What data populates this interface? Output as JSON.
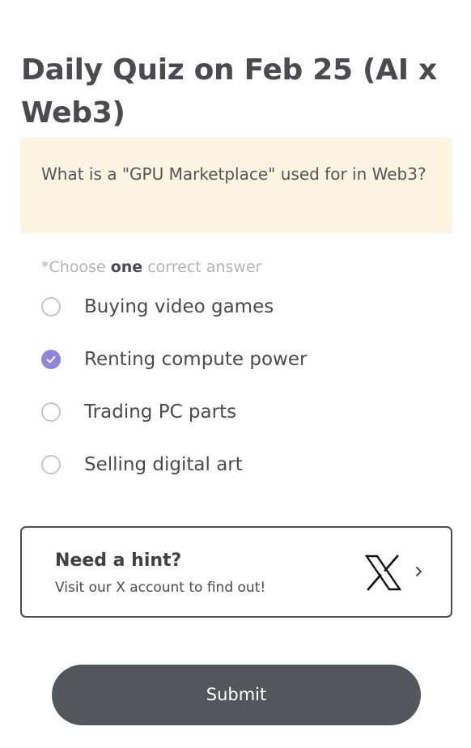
{
  "quiz": {
    "title": "Daily Quiz on Feb 25 (AI x Web3)",
    "question": "What is a \"GPU Marketplace\" used for in Web3?",
    "instruction": {
      "prefix": "*Choose ",
      "emphasis": "one",
      "suffix": " correct answer"
    },
    "options": [
      {
        "label": "Buying video games",
        "selected": false
      },
      {
        "label": "Renting compute power",
        "selected": true
      },
      {
        "label": "Trading PC parts",
        "selected": false
      },
      {
        "label": "Selling digital art",
        "selected": false
      }
    ]
  },
  "hint": {
    "title": "Need a hint?",
    "subtitle": "Visit our X account to find out!",
    "icon": "x-logo-icon",
    "chevron_icon": "chevron-right-icon"
  },
  "submit": {
    "label": "Submit"
  },
  "colors": {
    "accent": "#8f86d8",
    "question_bg": "#fdf3e1",
    "submit_bg": "#55555c",
    "text": "#4a4a4f",
    "muted": "#b4b4b8"
  }
}
